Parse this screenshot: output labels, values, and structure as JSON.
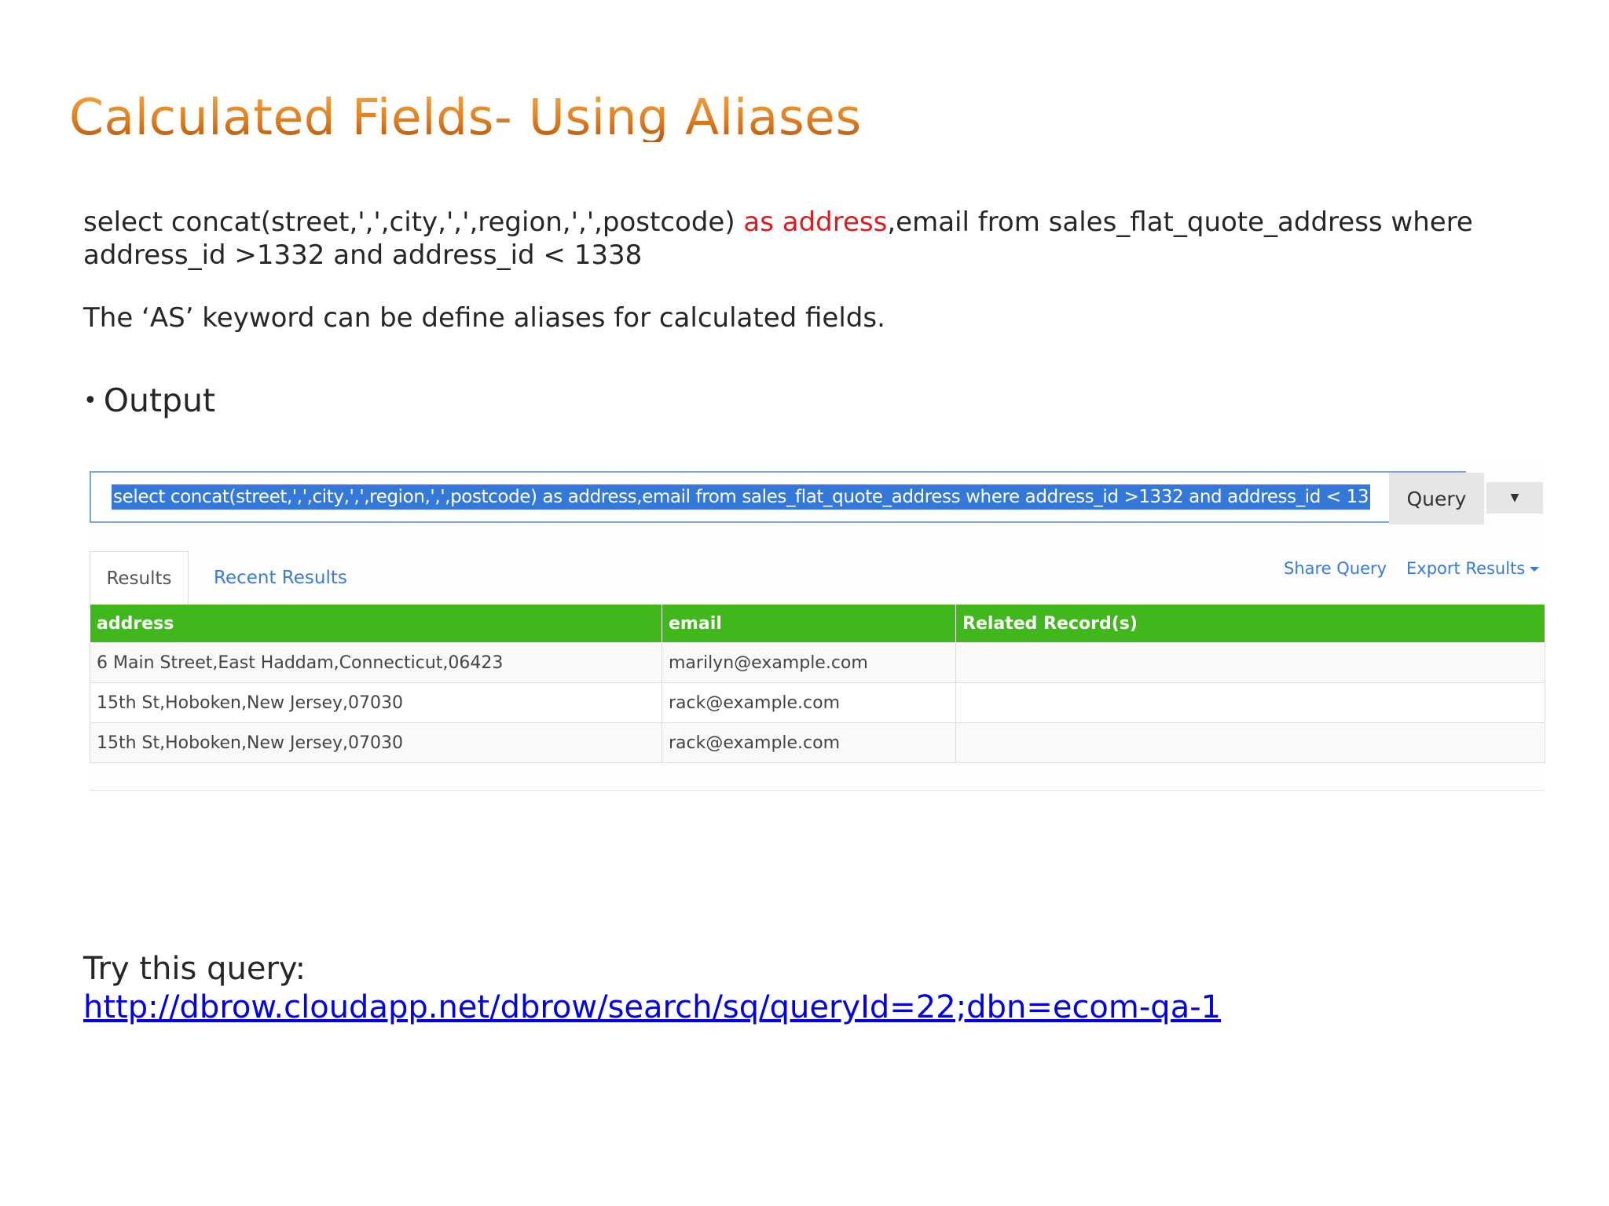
{
  "slide": {
    "title": "Calculated Fields- Using Aliases",
    "sql_before": "select concat(street,',',city,',',region,',',postcode) ",
    "sql_alias": "as address",
    "sql_after": ",email from sales_flat_quote_address where address_id >1332 and address_id < 1338",
    "explanation": "The ‘AS’ keyword can be define aliases for calculated fields.",
    "bullet": "Output",
    "try_label": "Try this query:",
    "try_link": "http://dbrow.cloudapp.net/dbrow/search/sq/queryId=22;dbn=ecom-qa-1"
  },
  "query_panel": {
    "query_text": "select concat(street,',',city,',',region,',',postcode) as address,email from sales_flat_quote_address where address_id >1332 and address_id < 13",
    "query_button": "Query",
    "tabs": [
      "Results",
      "Recent Results"
    ],
    "share_link": "Share Query",
    "export_link": "Export Results"
  },
  "results_table": {
    "columns": [
      "address",
      "email",
      "Related Record(s)"
    ],
    "rows": [
      [
        "6 Main Street,East Haddam,Connecticut,06423",
        "marilyn@example.com",
        ""
      ],
      [
        "15th St,Hoboken,New Jersey,07030",
        "rack@example.com",
        ""
      ],
      [
        "15th St,Hoboken,New Jersey,07030",
        "rack@example.com",
        ""
      ]
    ]
  },
  "colors": {
    "title_orange": "#e07d1f",
    "alias_red": "#e0191b",
    "table_header_green": "#40b81b",
    "selection_blue": "#3479d9",
    "link_blue": "#0000ee"
  }
}
